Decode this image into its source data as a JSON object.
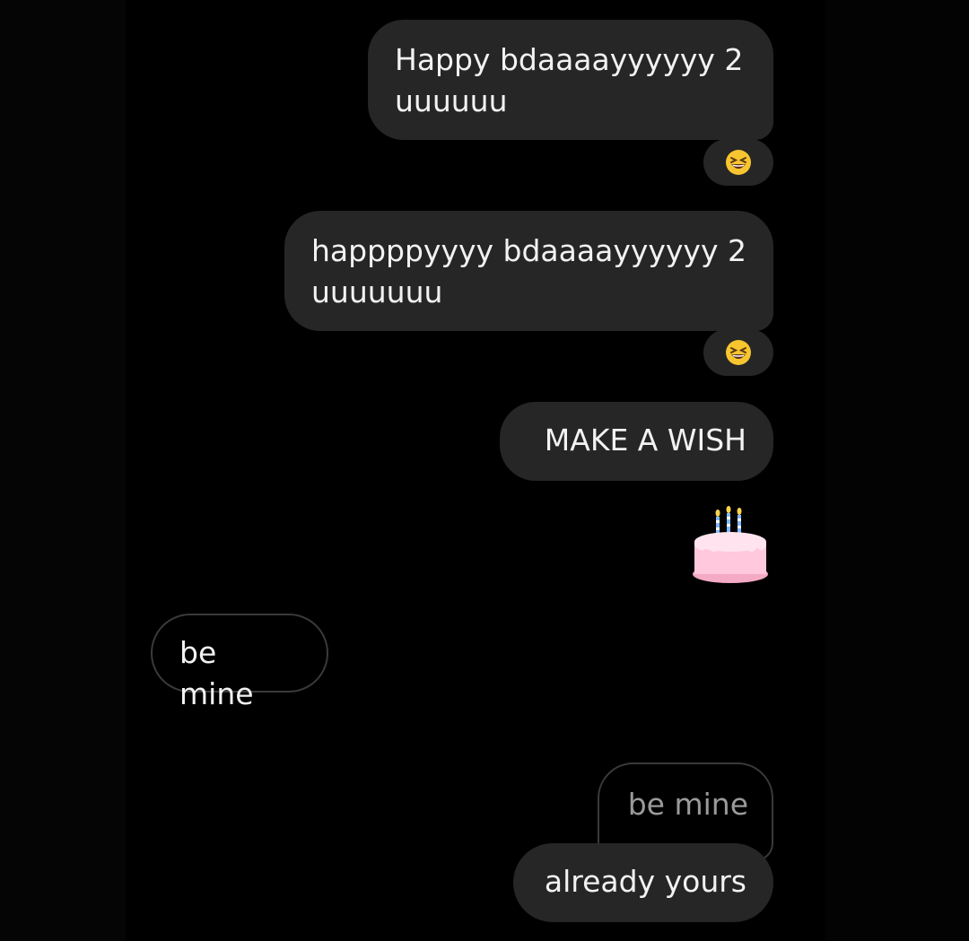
{
  "messages": [
    {
      "id": "m1",
      "text": "Happy bdaaaayyyyyy 2\nuuuuuu",
      "side": "outgoing",
      "reaction": "grinning-squinting-face"
    },
    {
      "id": "m2",
      "text": "happppyyyy bdaaaayyyyyy 2\nuuuuuuu",
      "side": "outgoing",
      "reaction": "grinning-squinting-face"
    },
    {
      "id": "m3",
      "text": "MAKE A WISH",
      "side": "outgoing"
    },
    {
      "id": "m4",
      "emoji": "birthday-cake",
      "side": "outgoing"
    },
    {
      "id": "m5",
      "text": "be mine",
      "side": "incoming"
    },
    {
      "id": "m6",
      "quoted_text": "be mine",
      "text": "already yours",
      "side": "outgoing"
    }
  ],
  "colors": {
    "background": "#000000",
    "bubble": "#262626",
    "text": "#f2f2f2",
    "quoted_text": "#9a9a9a",
    "border": "#3a3a3a"
  }
}
